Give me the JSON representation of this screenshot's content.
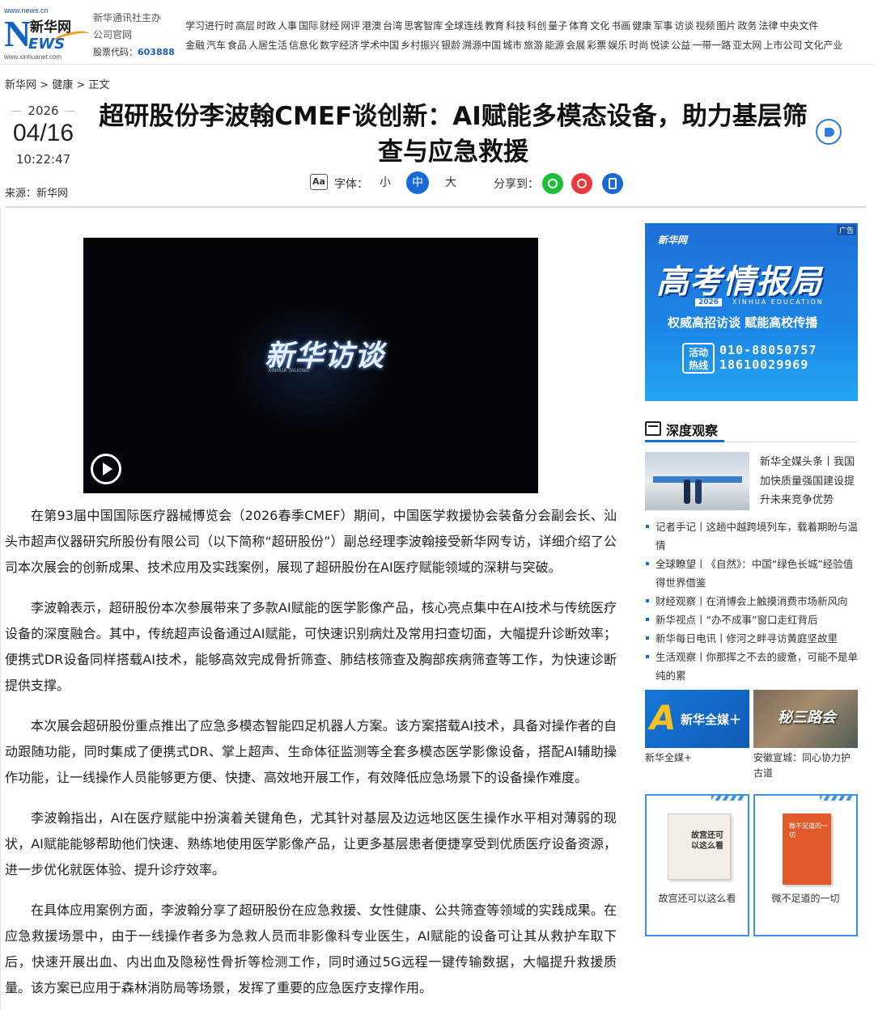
{
  "header": {
    "logo": {
      "url_top": "www.news.cn",
      "n": "N",
      "cn": "新华网",
      "ews": "EWS",
      "url_bottom": "www.xinhuanet.com"
    },
    "host_line1": "新华通讯社主办",
    "host_line2": "公司官网",
    "stock_label": "股票代码：",
    "stock_code": "603888",
    "nav_row1": [
      "学习进行时",
      "高层",
      "时政",
      "人事",
      "国际",
      "财经",
      "网评",
      "港澳",
      "台湾",
      "思客智库",
      "全球连线",
      "教育",
      "科技",
      "科创",
      "量子",
      "体育",
      "文化",
      "书画",
      "健康",
      "军事",
      "访谈",
      "视频",
      "图片",
      "政务",
      "法律",
      "中央文件"
    ],
    "nav_row2": [
      "金融",
      "汽车",
      "食品",
      "人居生活",
      "信息化",
      "数字经济",
      "学术中国",
      "乡村振兴",
      "银龄",
      "溯源中国",
      "城市",
      "旅游",
      "能源",
      "会展",
      "彩票",
      "娱乐",
      "时尚",
      "悦读",
      "公益",
      "一带一路",
      "亚太网",
      "上市公司",
      "文化产业"
    ]
  },
  "breadcrumb": [
    "新华网",
    "健康",
    "正文"
  ],
  "breadcrumb_sep": ">",
  "meta": {
    "year": "2026",
    "month_day": "04/16",
    "time": "10:22:47",
    "source": "来源：新华网"
  },
  "title": "超研股份李波翰CMEF谈创新：AI赋能多模态设备，助力基层筛查与应急救援",
  "tools": {
    "font_icon": "Aa",
    "font_label": "字体：",
    "small": "小",
    "medium": "中",
    "large": "大",
    "share_label": "分享到："
  },
  "icons": {
    "audio": "speaker-icon",
    "wechat": "wechat-icon",
    "weibo": "weibo-icon",
    "mobile": "mobile-icon",
    "play": "play-icon"
  },
  "video": {
    "brand": "新华访谈",
    "brand_sub": "XINHUA TALKING"
  },
  "article": [
    "在第93届中国国际医疗器械博览会（2026春季CMEF）期间，中国医学救援协会装备分会副会长、汕头市超声仪器研究所股份有限公司（以下简称“超研股份”）副总经理李波翰接受新华网专访，详细介绍了公司本次展会的创新成果、技术应用及实践案例，展现了超研股份在AI医疗赋能领域的深耕与突破。",
    "李波翰表示，超研股份本次参展带来了多款AI赋能的医学影像产品，核心亮点集中在AI技术与传统医疗设备的深度融合。其中，传统超声设备通过AI赋能，可快速识别病灶及常用扫查切面，大幅提升诊断效率；便携式DR设备同样搭载AI技术，能够高效完成骨折筛查、肺结核筛查及胸部疾病筛查等工作，为快速诊断提供支撑。",
    "本次展会超研股份重点推出了应急多模态智能四足机器人方案。该方案搭载AI技术，具备对操作者的自动跟随功能，同时集成了便携式DR、掌上超声、生命体征监测等全套多模态医学影像设备，搭配AI辅助操作功能，让一线操作人员能够更方便、快捷、高效地开展工作，有效降低应急场景下的设备操作难度。",
    "李波翰指出，AI在医疗赋能中扮演着关键角色，尤其针对基层及边远地区医生操作水平相对薄弱的现状，AI赋能能够帮助他们快速、熟练地使用医学影像产品，让更多基层患者便捷享受到优质医疗设备资源，进一步优化就医体验、提升诊疗效率。",
    "在具体应用案例方面，李波翰分享了超研股份在应急救援、女性健康、公共筛查等领域的实践成果。在应急救援场景中，由于一线操作者多为急救人员而非影像科专业医生，AI赋能的设备可让其从救护车取下后，快速开展出血、内出血及隐秘性骨折等检测工作，同时通过5G远程一键传输数据，大幅提升救援质量。该方案已应用于森林消防局等场景，发挥了重要的应急医疗支撑作用。"
  ],
  "sidebar": {
    "ad": {
      "tag": "广告",
      "logo": "新华网",
      "headline": "高考情报局",
      "year": "2026",
      "edu": "XINHUA EDUCATION",
      "slogan": "权威高招访谈  赋能高校传播",
      "hotline_label": "活动 热线",
      "tel1": "010-88050757",
      "tel2": "18610029969"
    },
    "section_title": "深度观察",
    "featured_text": "新华全媒头条丨我国加快质量强国建设提升未来竞争优势",
    "news": [
      "记者手记丨这趟中越跨境列车，载着期盼与温情",
      "全球瞭望丨《自然》：中国“绿色长城”经验值得世界借鉴",
      "财经观察丨在消博会上触摸消费市场新风向",
      "新华视点丨“办不成事”窗口走红背后",
      "新华每日电讯丨修河之畔寻访黄庭坚故里",
      "生活观察丨你那挥之不去的疲惫，可能不是单纯的累"
    ],
    "thumbs": [
      {
        "overlay": "新华全媒＋",
        "caption": "新华全媒+"
      },
      {
        "overlay": "秘三路会",
        "caption": "安徽宣城：同心协力护古道"
      }
    ],
    "books": [
      {
        "cover": "故宫还可以这么看",
        "title": "故宫还可以这么看"
      },
      {
        "cover": "微不足道的一切",
        "title": "微不足道的一切"
      }
    ]
  }
}
